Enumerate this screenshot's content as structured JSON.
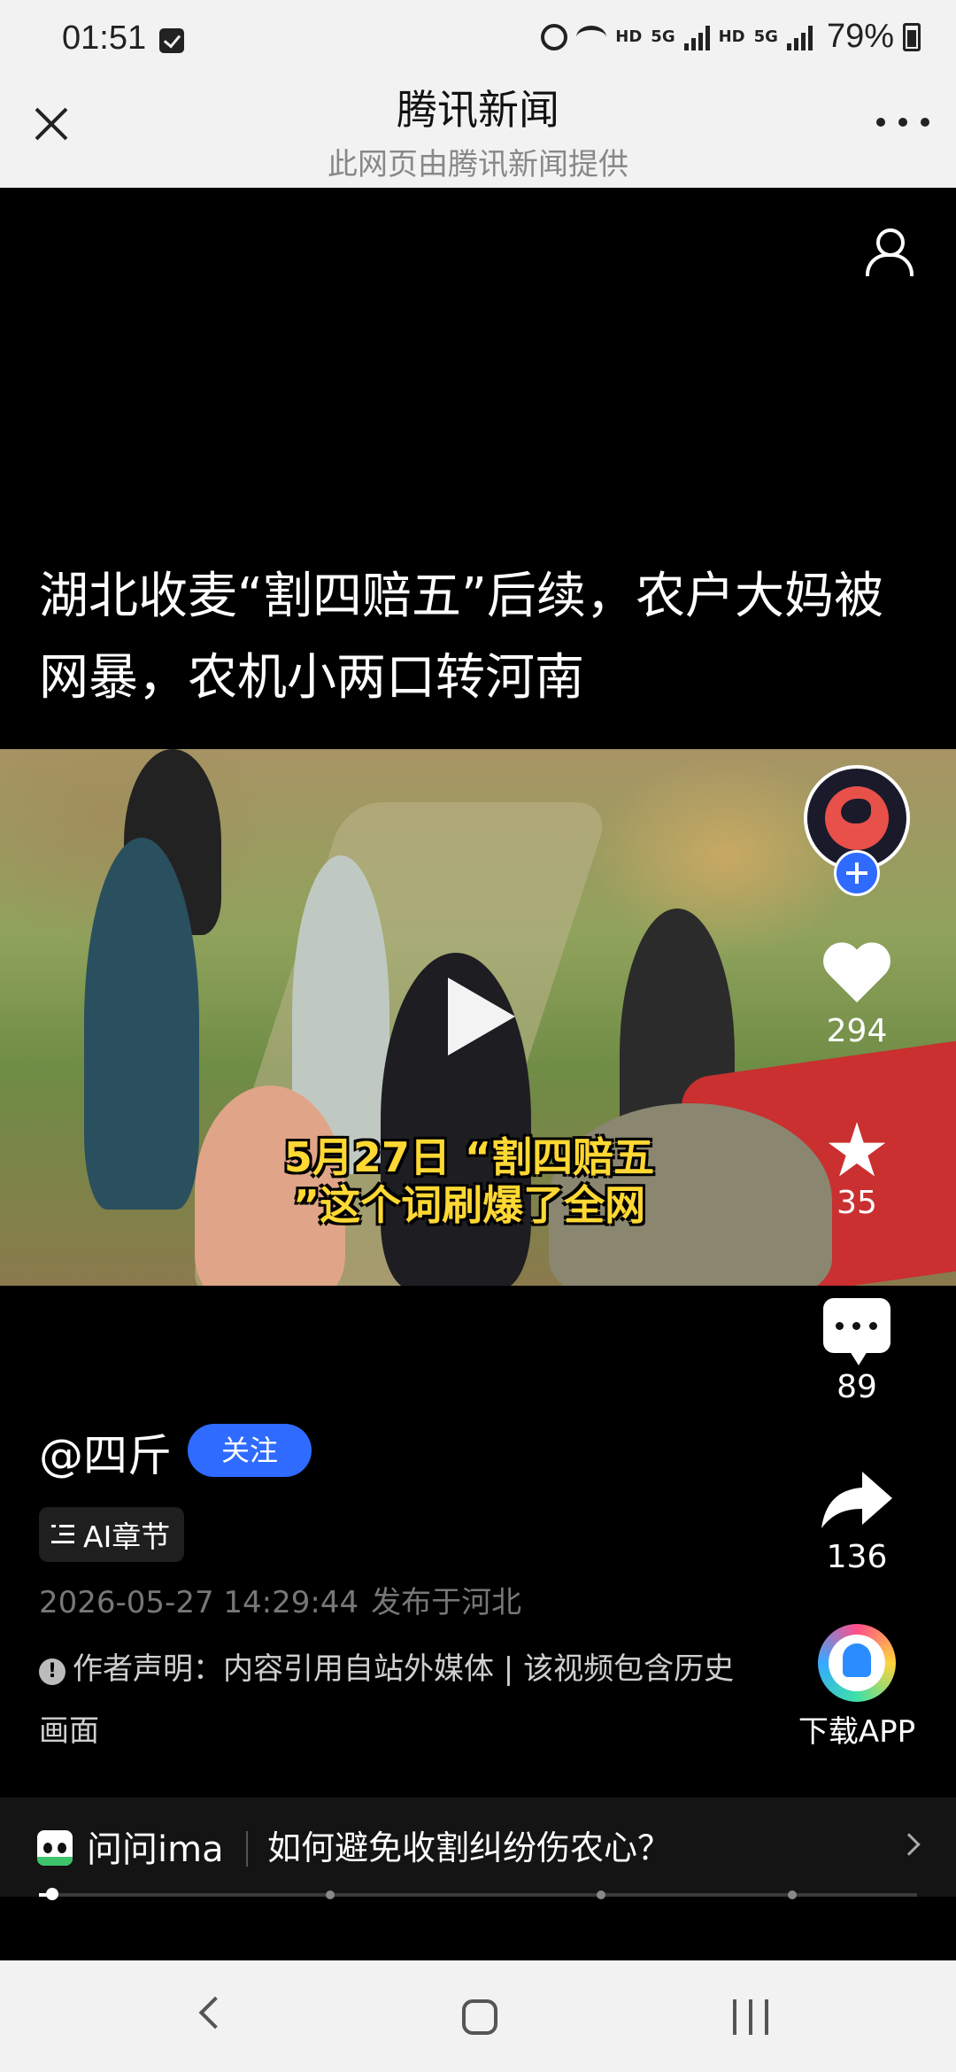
{
  "status_bar": {
    "time": "01:51",
    "hd1": "HD",
    "net1": "5G",
    "hd2": "HD",
    "net2": "5G",
    "battery": "79%"
  },
  "header": {
    "title": "腾讯新闻",
    "subtitle": "此网页由腾讯新闻提供"
  },
  "article": {
    "title": "湖北收麦“割四赔五”后续，农户大妈被网暴，农机小两口转河南"
  },
  "video": {
    "caption_line1": "5月27日 “割四赔五",
    "caption_line2": "”这个词刷爆了全网",
    "progress": 0.015
  },
  "actions": {
    "likes": "294",
    "favorites": "35",
    "comments": "89",
    "shares": "136",
    "download_label": "下载APP"
  },
  "author": {
    "name": "@四斤",
    "follow_label": "关注",
    "ai_chapter_label": "AI章节",
    "publish_time": "2026-05-27 14:29:44",
    "publish_location": "发布于河北",
    "disclaimer": "作者声明：内容引用自站外媒体 | 该视频包含历史画面"
  },
  "ima": {
    "label": "问问ima",
    "question": "如何避免收割纠纷伤农心？"
  },
  "icons": [
    "check-icon",
    "alarm-icon",
    "wifi-icon",
    "signal-icon",
    "battery-icon",
    "close-icon",
    "more-icon",
    "profile-icon",
    "play-icon",
    "avatar",
    "plus-icon",
    "heart-icon",
    "star-icon",
    "comment-icon",
    "share-icon",
    "app-icon",
    "list-icon",
    "warning-icon",
    "panda-icon",
    "chevron-right-icon",
    "back-icon",
    "home-icon",
    "recent-apps-icon"
  ]
}
